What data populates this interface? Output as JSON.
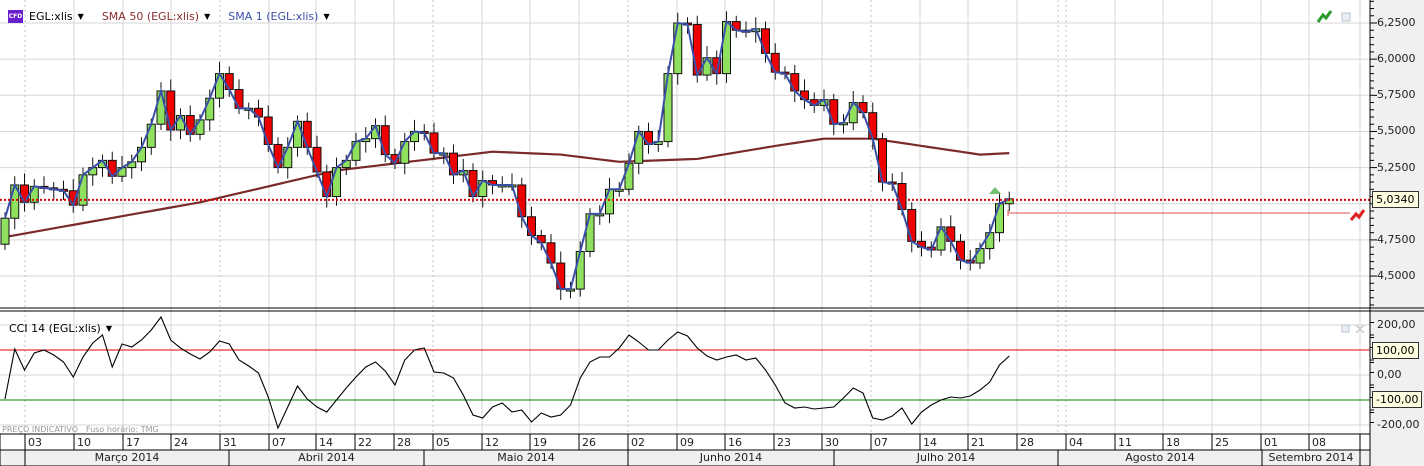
{
  "legend": {
    "instrument_badge": "CFD",
    "instrument": "EGL:xlis",
    "sma50": "SMA 50 (EGL:xlis)",
    "sma1": "SMA 1 (EGL:xlis)",
    "cci": "CCI 14 (EGL:xlis)"
  },
  "footnote": {
    "price_note": "PREÇO INDICATIVO",
    "timezone": "Fuso horário: TMG"
  },
  "colors": {
    "up": "#90e060",
    "down": "#ee0000",
    "sma50": "#7a2a2a",
    "sma1": "#3a4fa8",
    "cci": "#000000",
    "cci_upper": "#e00000",
    "cci_lower": "#008000",
    "current_price": "#dd0000"
  },
  "chart_data": [
    {
      "type": "candlestick",
      "title": "EGL:xlis",
      "ylim": [
        4.3,
        6.4
      ],
      "yticks": [
        "6,2500",
        "6,0000",
        "5,7500",
        "5,5000",
        "5,2500",
        "4,7500",
        "4,5000"
      ],
      "ytick_values": [
        6.25,
        6.0,
        5.75,
        5.5,
        5.25,
        4.75,
        4.5
      ],
      "current_price_label": "5,0340",
      "current_price": 5.034,
      "first_open": 4.72,
      "close": [
        4.9,
        5.13,
        5.01,
        5.12,
        5.11,
        5.1,
        5.09,
        4.99,
        5.2,
        5.25,
        5.3,
        5.19,
        5.25,
        5.29,
        5.39,
        5.55,
        5.78,
        5.51,
        5.61,
        5.48,
        5.58,
        5.73,
        5.9,
        5.79,
        5.66,
        5.66,
        5.6,
        5.41,
        5.25,
        5.39,
        5.57,
        5.39,
        5.22,
        5.05,
        5.25,
        5.3,
        5.43,
        5.45,
        5.54,
        5.34,
        5.28,
        5.43,
        5.5,
        5.49,
        5.35,
        5.35,
        5.2,
        5.23,
        5.05,
        5.16,
        5.13,
        5.13,
        5.13,
        4.91,
        4.78,
        4.73,
        4.59,
        4.41,
        4.41,
        4.67,
        4.93,
        4.93,
        5.1,
        5.1,
        5.28,
        5.5,
        5.41,
        5.43,
        5.9,
        6.25,
        6.24,
        5.89,
        6.01,
        5.9,
        6.26,
        6.2,
        6.19,
        6.21,
        6.04,
        5.91,
        5.9,
        5.78,
        5.72,
        5.68,
        5.72,
        5.55,
        5.56,
        5.7,
        5.63,
        5.45,
        5.15,
        5.14,
        4.96,
        4.74,
        4.7,
        4.68,
        4.84,
        4.74,
        4.61,
        4.59,
        4.69,
        4.8,
        5.0,
        5.034
      ],
      "sma50": [
        [
          0,
          4.77
        ],
        [
          20,
          5.01
        ],
        [
          34,
          5.23
        ],
        [
          50,
          5.36
        ],
        [
          57,
          5.34
        ],
        [
          63,
          5.29
        ],
        [
          71,
          5.31
        ],
        [
          79,
          5.4
        ],
        [
          84,
          5.45
        ],
        [
          89,
          5.45
        ],
        [
          94,
          5.4
        ],
        [
          100,
          5.34
        ],
        [
          103,
          5.35
        ]
      ]
    },
    {
      "type": "line",
      "title": "CCI 14 (EGL:xlis)",
      "ylim": [
        -240,
        240
      ],
      "yticks": [
        "200,00",
        "0,00",
        "-200,00"
      ],
      "ytick_values": [
        200,
        0,
        -200
      ],
      "levels": [
        {
          "value": 100,
          "label": "100,00"
        },
        {
          "value": -100,
          "label": "-100,00"
        }
      ],
      "values": [
        -96,
        104,
        20,
        88,
        100,
        80,
        52,
        -8,
        72,
        128,
        160,
        32,
        124,
        112,
        140,
        180,
        232,
        140,
        108,
        84,
        64,
        92,
        136,
        124,
        60,
        36,
        8,
        -88,
        -212,
        -128,
        -44,
        -96,
        -128,
        -148,
        -100,
        -52,
        -8,
        32,
        52,
        16,
        -40,
        60,
        100,
        108,
        12,
        8,
        -12,
        -80,
        -160,
        -172,
        -128,
        -112,
        -148,
        -140,
        -188,
        -152,
        -168,
        -160,
        -120,
        -12,
        52,
        72,
        72,
        108,
        160,
        132,
        100,
        100,
        140,
        172,
        156,
        108,
        76,
        60,
        72,
        80,
        60,
        68,
        20,
        -40,
        -112,
        -132,
        -128,
        -136,
        -132,
        -128,
        -92,
        -52,
        -72,
        -172,
        -180,
        -164,
        -132,
        -196,
        -148,
        -120,
        -100,
        -88,
        -92,
        -84,
        -60,
        -28,
        40,
        76
      ]
    }
  ],
  "x_axis": {
    "weeks": [
      "03",
      "10",
      "17",
      "24",
      "31",
      "07",
      "14",
      "22",
      "28",
      "05",
      "12",
      "19",
      "26",
      "02",
      "09",
      "16",
      "23",
      "30",
      "07",
      "14",
      "21",
      "28",
      "04",
      "11",
      "18",
      "25",
      "01",
      "08"
    ],
    "months": [
      "Março 2014",
      "Abril 2014",
      "Maio 2014",
      "Junho 2014",
      "Julho 2014",
      "Agosto 2014",
      "Setembro 2014"
    ]
  }
}
